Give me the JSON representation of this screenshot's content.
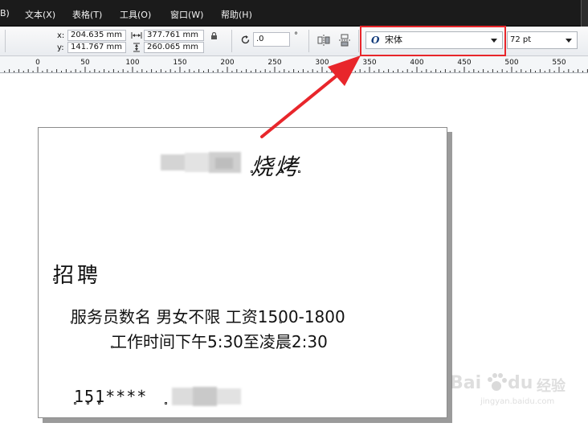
{
  "menu": {
    "items": [
      "B)",
      "文本(X)",
      "表格(T)",
      "工具(O)",
      "窗口(W)",
      "帮助(H)"
    ]
  },
  "propbar": {
    "x_label": "x:",
    "x_value": "204.635 mm",
    "y_label": "y:",
    "y_value": "141.767 mm",
    "width_value": "377.761 mm",
    "height_value": "260.065 mm",
    "rotation_value": ".0",
    "degree_symbol": "°",
    "font_icon_letter": "O",
    "font_name": "宋体",
    "font_size": "72 pt"
  },
  "ruler": {
    "labels": [
      "0",
      "50",
      "100",
      "150",
      "200",
      "250",
      "300",
      "350",
      "400",
      "450",
      "500",
      "550"
    ]
  },
  "document": {
    "title_visible": "烧烤",
    "heading": "招聘",
    "line1": "服务员数名 男女不限  工资1500-1800",
    "line2": "工作时间下午5:30至凌晨2:30",
    "phone_visible": "151****"
  },
  "watermark": {
    "brand": "Bai",
    "brand2": "du",
    "site": "经验",
    "url": "jingyan.baidu.com"
  },
  "colors": {
    "menubar_bg": "#1b1b1b",
    "highlight": "#e8262b",
    "arrow": "#e8262b"
  }
}
